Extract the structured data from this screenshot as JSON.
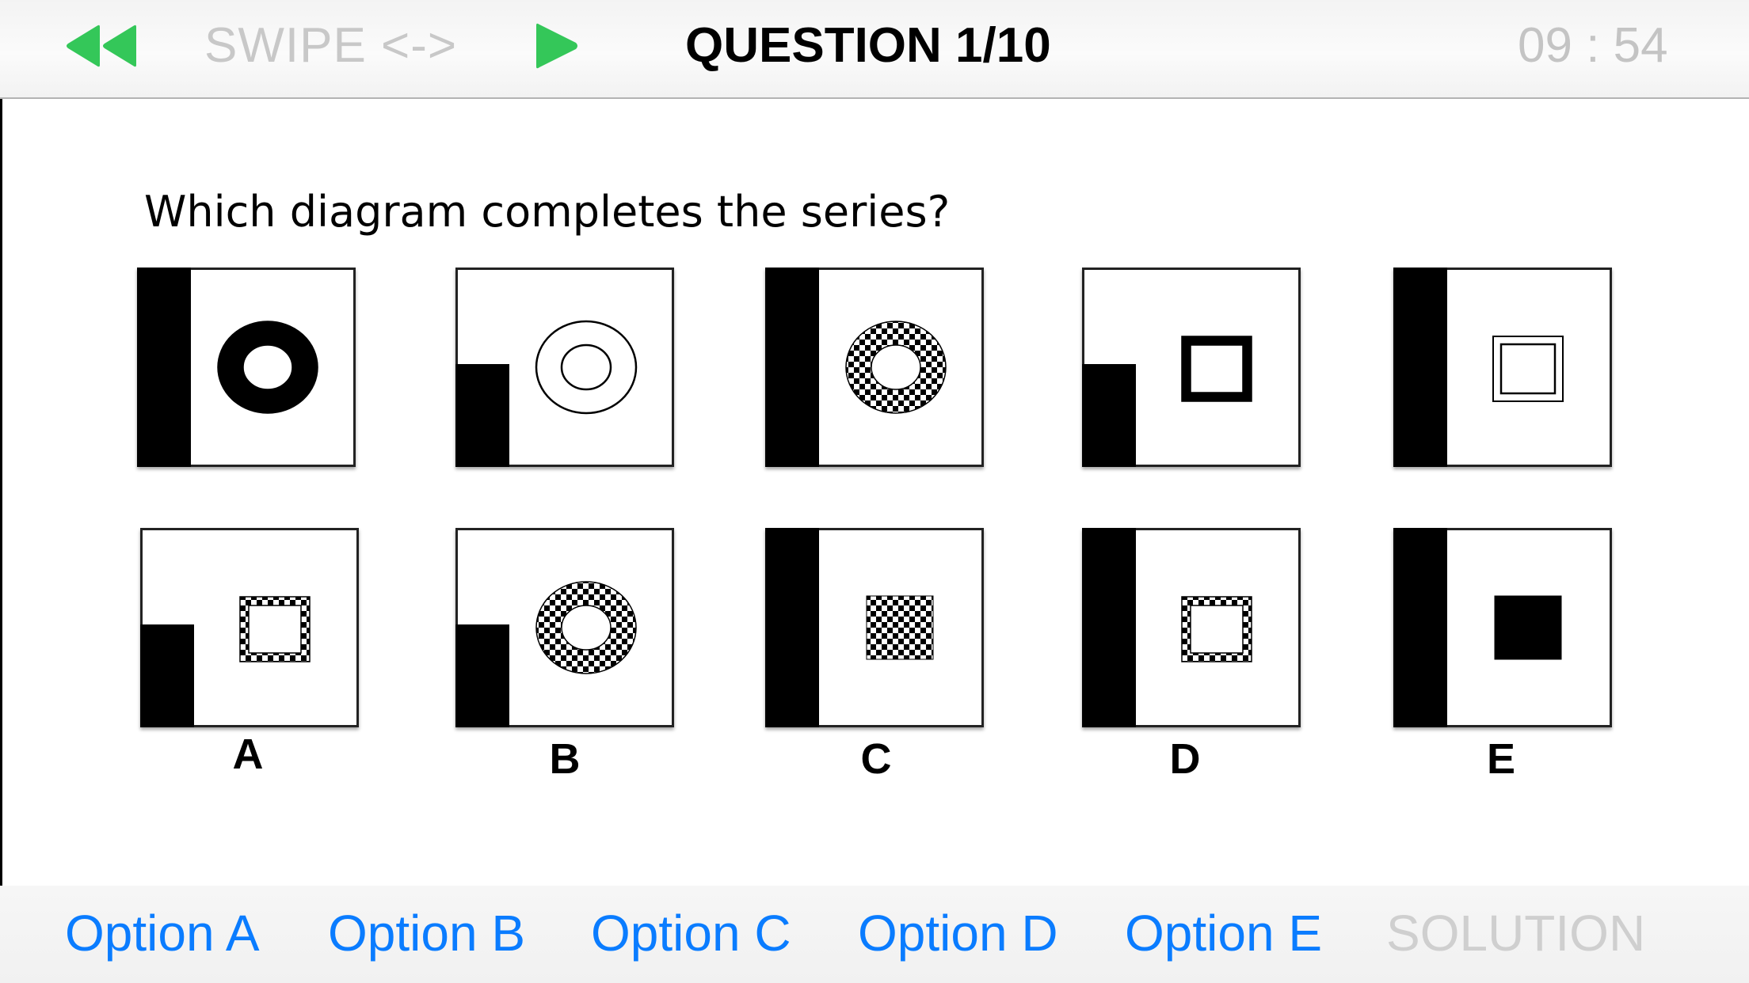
{
  "header": {
    "rewind_icon": "rewind-icon",
    "swipe_label": "SWIPE <->",
    "play_icon": "play-icon",
    "title": "QUESTION 1/10",
    "timer": "09 : 54",
    "accent_color": "#34c759"
  },
  "question": {
    "text": "Which diagram completes the series?",
    "series": [
      {
        "bar": "full",
        "shape": "ring",
        "fill": "solid-black"
      },
      {
        "bar": "short",
        "shape": "ring",
        "fill": "outline"
      },
      {
        "bar": "full",
        "shape": "ring",
        "fill": "checkered"
      },
      {
        "bar": "short",
        "shape": "square-frame",
        "fill": "solid-black"
      },
      {
        "bar": "full",
        "shape": "square-frame",
        "fill": "outline"
      }
    ],
    "options": [
      {
        "label": "A",
        "bar": "short",
        "shape": "square-frame",
        "fill": "checkered"
      },
      {
        "label": "B",
        "bar": "short",
        "shape": "ring",
        "fill": "checkered"
      },
      {
        "label": "C",
        "bar": "full",
        "shape": "square",
        "fill": "checkered"
      },
      {
        "label": "D",
        "bar": "full",
        "shape": "square-frame",
        "fill": "checkered"
      },
      {
        "label": "E",
        "bar": "full",
        "shape": "square",
        "fill": "solid-black"
      }
    ]
  },
  "footer": {
    "buttons": [
      {
        "label": "Option A"
      },
      {
        "label": "Option B"
      },
      {
        "label": "Option C"
      },
      {
        "label": "Option D"
      },
      {
        "label": "Option E"
      }
    ],
    "solution_label": "SOLUTION",
    "link_color": "#0a7cff",
    "disabled_color": "#cfcfcf"
  }
}
